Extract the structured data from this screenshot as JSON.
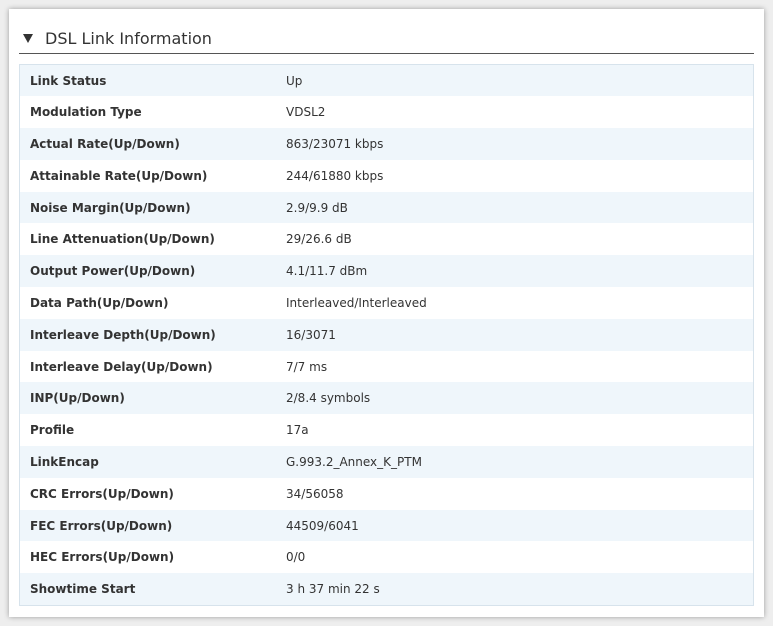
{
  "panel": {
    "title": "DSL Link Information"
  },
  "rows": [
    {
      "label": "Link Status",
      "value": "Up"
    },
    {
      "label": "Modulation Type",
      "value": "VDSL2"
    },
    {
      "label": "Actual Rate(Up/Down)",
      "value": "863/23071 kbps"
    },
    {
      "label": "Attainable Rate(Up/Down)",
      "value": "244/61880 kbps"
    },
    {
      "label": "Noise Margin(Up/Down)",
      "value": "2.9/9.9 dB"
    },
    {
      "label": "Line Attenuation(Up/Down)",
      "value": "29/26.6 dB"
    },
    {
      "label": "Output Power(Up/Down)",
      "value": "4.1/11.7 dBm"
    },
    {
      "label": "Data Path(Up/Down)",
      "value": "Interleaved/Interleaved"
    },
    {
      "label": "Interleave Depth(Up/Down)",
      "value": "16/3071"
    },
    {
      "label": "Interleave Delay(Up/Down)",
      "value": "7/7 ms"
    },
    {
      "label": "INP(Up/Down)",
      "value": "2/8.4 symbols"
    },
    {
      "label": "Profile",
      "value": "17a"
    },
    {
      "label": "LinkEncap",
      "value": "G.993.2_Annex_K_PTM"
    },
    {
      "label": "CRC Errors(Up/Down)",
      "value": "34/56058"
    },
    {
      "label": "FEC Errors(Up/Down)",
      "value": "44509/6041"
    },
    {
      "label": "HEC Errors(Up/Down)",
      "value": "0/0"
    },
    {
      "label": "Showtime Start",
      "value": "3 h 37 min 22 s"
    }
  ],
  "colors": {
    "stripe": "#eff6fb",
    "border": "#d7e3ec",
    "text": "#333333"
  },
  "icons": {
    "collapse": "triangle-down-icon"
  }
}
